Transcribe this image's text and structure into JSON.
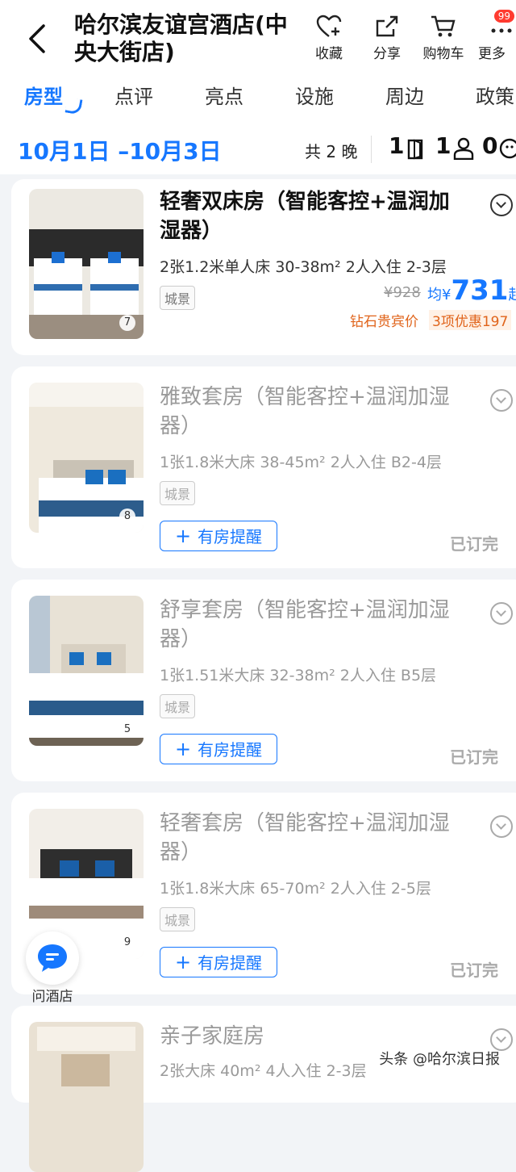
{
  "header": {
    "title": "哈尔滨友谊宫酒店(中央大街店)",
    "actions": [
      {
        "label": "收藏",
        "icon": "heart-plus-icon"
      },
      {
        "label": "分享",
        "icon": "share-icon"
      },
      {
        "label": "购物车",
        "icon": "cart-icon"
      },
      {
        "label": "更多",
        "icon": "more-icon",
        "badge": "99"
      }
    ]
  },
  "tabs": [
    "房型",
    "点评",
    "亮点",
    "设施",
    "周边",
    "政策"
  ],
  "active_tab": "房型",
  "date_bar": {
    "dates": "10月1日 –10月3日",
    "nights": "共 2 晚",
    "rooms": "1",
    "adults": "1",
    "children": "0"
  },
  "rooms": [
    {
      "name": "轻奢双床房（智能客控+温润加湿器）",
      "spec": "2张1.2米单人床  30-38m²  2人入住  2-3层",
      "tag": "城景",
      "photo_count": "7",
      "old_price": "¥928",
      "price_prefix": "均¥",
      "price": "731",
      "price_suffix": "起",
      "promo1": "钻石贵宾价",
      "promo2": "3项优惠197"
    },
    {
      "name": "雅致套房（智能客控+温润加湿器）",
      "spec": "1张1.8米大床  38-45m²  2人入住  B2-4层",
      "tag": "城景",
      "photo_count": "8",
      "remind": "有房提醒",
      "status": "已订完"
    },
    {
      "name": "舒享套房（智能客控+温润加湿器）",
      "spec": "1张1.51米大床  32-38m²  2人入住  B5层",
      "tag": "城景",
      "photo_count": "5",
      "remind": "有房提醒",
      "status": "已订完"
    },
    {
      "name": "轻奢套房（智能客控+温润加湿器）",
      "spec": "1张1.8米大床  65-70m²  2人入住  2-5层",
      "tag": "城景",
      "photo_count": "9",
      "remind": "有房提醒",
      "status": "已订完"
    },
    {
      "name": "亲子家庭房",
      "spec": "2张大床  40m²  4人入住  2-3层"
    }
  ],
  "ask_hotel": "问酒店",
  "watermark": "头条 @哈尔滨日报",
  "colors": {
    "accent": "#1677ff",
    "promo": "#e0641b",
    "soldout": "#aaaaaa"
  }
}
